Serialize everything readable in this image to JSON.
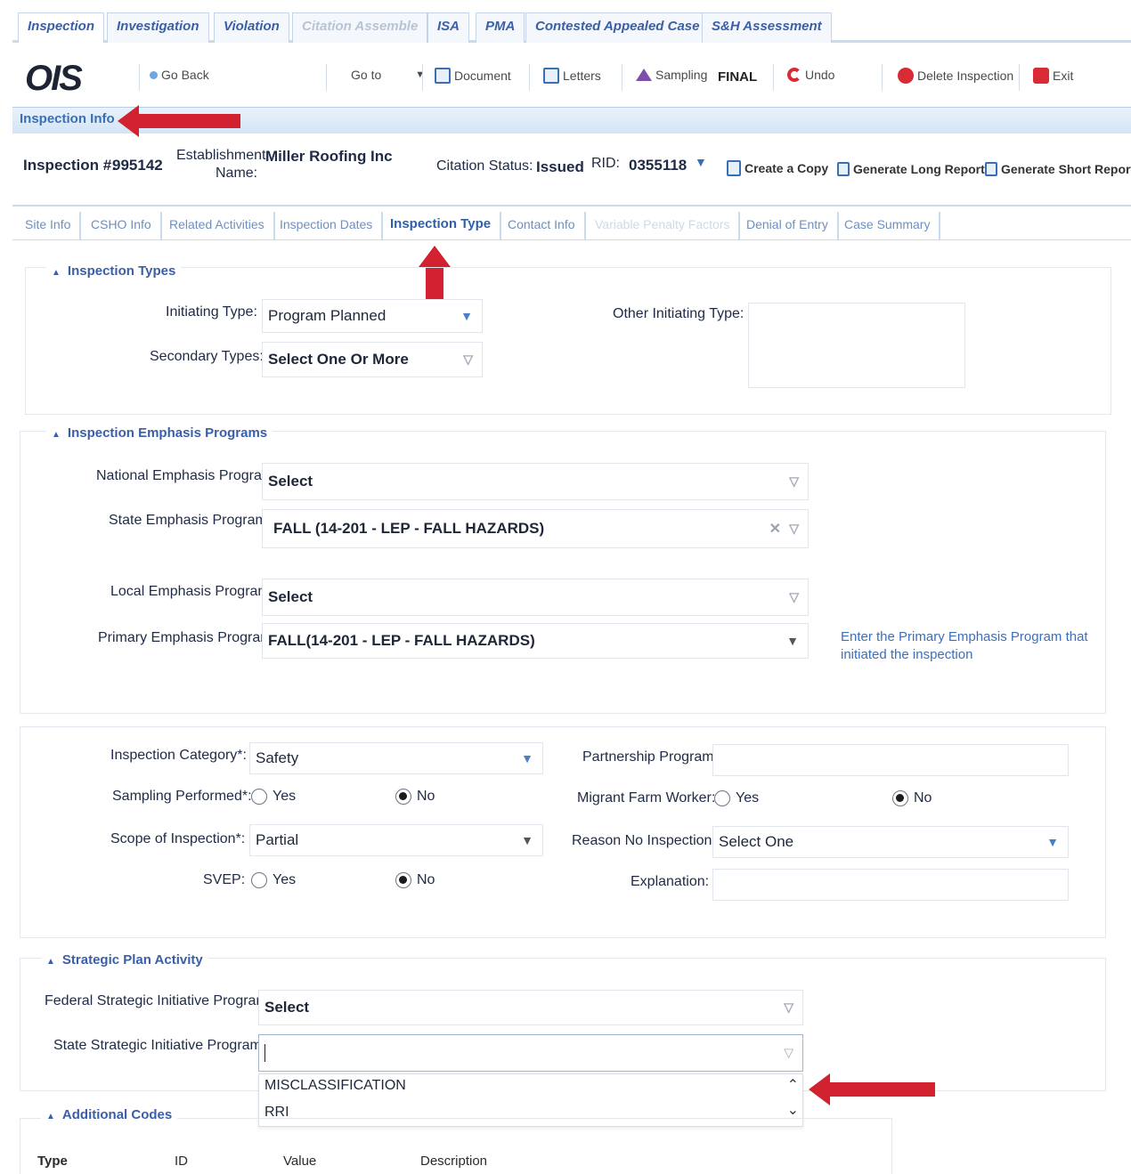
{
  "top_tabs": [
    {
      "label": "Inspection",
      "state": "active"
    },
    {
      "label": "Investigation",
      "state": "normal"
    },
    {
      "label": "Violation",
      "state": "normal"
    },
    {
      "label": "Citation Assemble",
      "state": "disabled"
    },
    {
      "label": "ISA",
      "state": "normal"
    },
    {
      "label": "PMA",
      "state": "normal"
    },
    {
      "label": "Contested Appealed Case",
      "state": "normal"
    },
    {
      "label": "S&H Assessment",
      "state": "normal"
    }
  ],
  "toolbar": {
    "logo": "OIS",
    "go_back": "Go Back",
    "goto": "Go to",
    "document": "Document",
    "letters": "Letters",
    "sampling": "Sampling",
    "final": "FINAL",
    "undo": "Undo",
    "delete_inspection": "Delete Inspection",
    "exit": "Exit"
  },
  "info_bar_title": "Inspection Info",
  "header": {
    "inspection_label": "Inspection #:",
    "inspection_value": "995142",
    "establishment_label_1": "Establishment",
    "establishment_label_2": "Name:",
    "establishment_value": "Miller Roofing Inc",
    "citation_status_label": "Citation Status:",
    "citation_status_value": "Issued",
    "rid_label": "RID:",
    "rid_value": "0355118",
    "create_copy": "Create a Copy",
    "long_report": "Generate Long Report",
    "short_report": "Generate Short Report"
  },
  "sub_tabs": [
    {
      "label": "Site Info",
      "state": "normal"
    },
    {
      "label": "CSHO Info",
      "state": "normal"
    },
    {
      "label": "Related Activities",
      "state": "normal"
    },
    {
      "label": "Inspection Dates",
      "state": "normal"
    },
    {
      "label": "Inspection Type",
      "state": "active"
    },
    {
      "label": "Contact Info",
      "state": "normal"
    },
    {
      "label": "Variable Penalty Factors",
      "state": "disabled"
    },
    {
      "label": "Denial of Entry",
      "state": "normal"
    },
    {
      "label": "Case Summary",
      "state": "normal"
    }
  ],
  "inspection_types": {
    "legend": "Inspection Types",
    "initiating_type_label": "Initiating Type:",
    "initiating_type_value": "Program Planned",
    "secondary_types_label": "Secondary Types:",
    "secondary_types_value": "Select One Or More",
    "other_initiating_label": "Other Initiating Type:"
  },
  "emphasis": {
    "legend": "Inspection Emphasis Programs",
    "national_label": "National Emphasis Program:",
    "national_value": "Select",
    "state_label": "State Emphasis Program:",
    "state_value": "FALL (14-201 - LEP - FALL HAZARDS)",
    "local_label": "Local Emphasis Program:",
    "local_value": "Select",
    "primary_label": "Primary Emphasis Program:",
    "primary_value": "FALL(14-201 - LEP - FALL HAZARDS)",
    "hint": "Enter the Primary Emphasis Program that initiated the inspection"
  },
  "category": {
    "inspection_category_label": "Inspection Category*:",
    "inspection_category_value": "Safety",
    "sampling_label": "Sampling Performed*:",
    "sampling_value": "No",
    "scope_label": "Scope of Inspection*:",
    "scope_value": "Partial",
    "svep_label": "SVEP:",
    "svep_value": "No",
    "partnership_label": "Partnership Program:",
    "partnership_value": "",
    "migrant_label": "Migrant Farm Worker:",
    "migrant_value": "No",
    "reason_label": "Reason No Inspection:",
    "reason_value": "Select One",
    "explanation_label": "Explanation:",
    "explanation_value": "",
    "yes": "Yes",
    "no": "No"
  },
  "strategic": {
    "legend": "Strategic Plan Activity",
    "federal_label": "Federal Strategic Initiative Program:",
    "federal_value": "Select",
    "state_label": "State Strategic Initiative Program:",
    "state_value": "",
    "options": [
      "MISCLASSIFICATION",
      "RRI"
    ]
  },
  "additional_codes": {
    "legend": "Additional Codes",
    "columns": [
      "Type",
      "ID",
      "Value",
      "Description"
    ]
  },
  "colors": {
    "accent": "#3a5fa8",
    "arrow": "#d3222f",
    "hint": "#3d6fb8"
  }
}
